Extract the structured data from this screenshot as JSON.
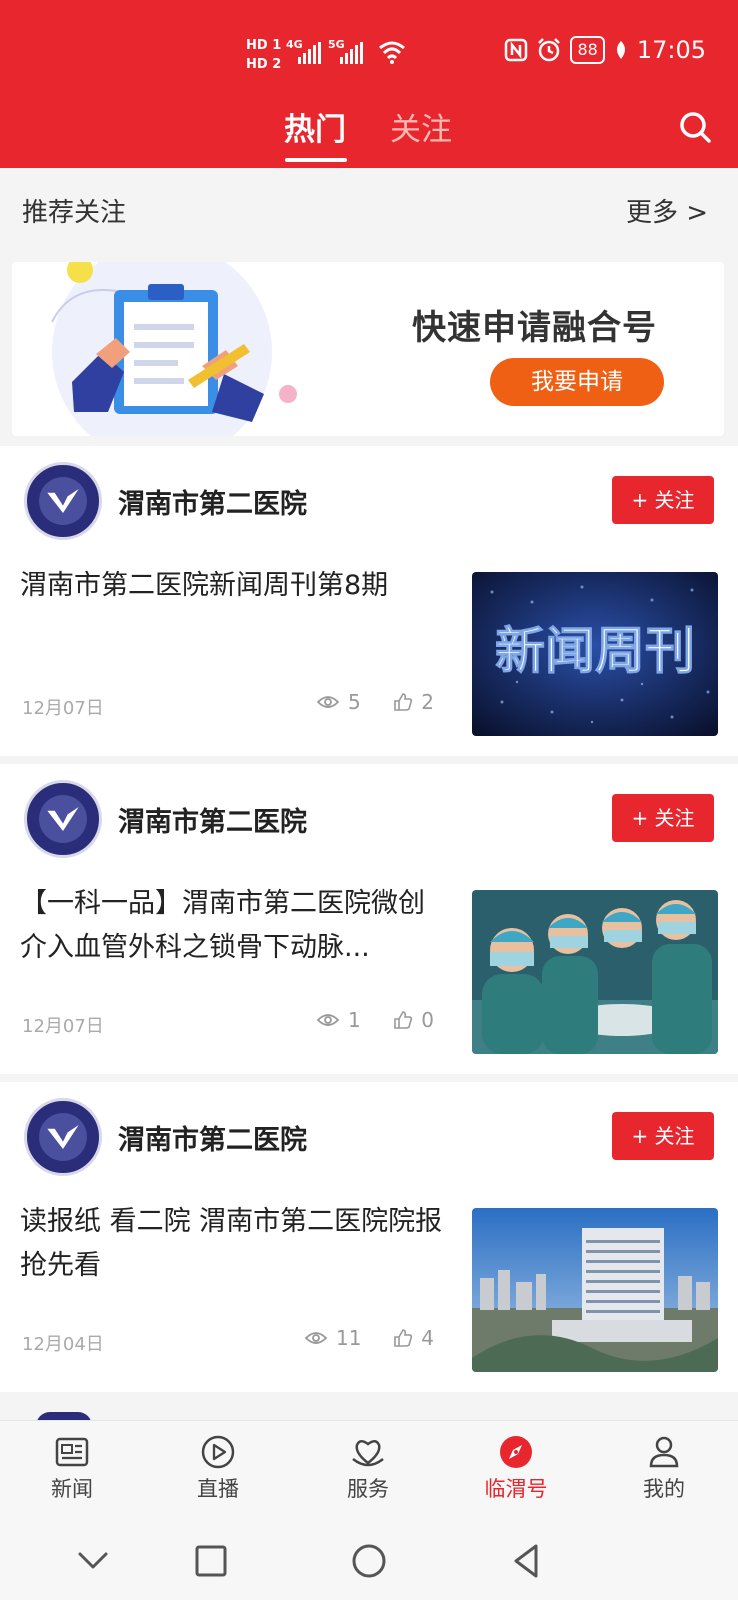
{
  "status_bar": {
    "hd1": "HD 1",
    "hd2": "HD 2",
    "net1": "4G",
    "net2": "5G",
    "battery": "88",
    "time": "17:05"
  },
  "header": {
    "tabs": [
      {
        "label": "热门",
        "active": true
      },
      {
        "label": "关注",
        "active": false
      }
    ],
    "search_icon": "search-icon",
    "background_color": "#e8262e"
  },
  "recommend": {
    "title": "推荐关注",
    "more": "更多 >"
  },
  "banner": {
    "title": "快速申请融合号",
    "button": "我要申请"
  },
  "feed": [
    {
      "source": "渭南市第二医院",
      "follow": "+ 关注",
      "title": "渭南市第二医院新闻周刊第8期",
      "date": "12月07日",
      "views": "5",
      "likes": "2",
      "thumb": "新闻周刊"
    },
    {
      "source": "渭南市第二医院",
      "follow": "+ 关注",
      "title": "【一科一品】渭南市第二医院微创介入血管外科之锁骨下动脉...",
      "date": "12月07日",
      "views": "1",
      "likes": "0",
      "thumb": ""
    },
    {
      "source": "渭南市第二医院",
      "follow": "+ 关注",
      "title": "读报纸 看二院 渭南市第二医院院报抢先看",
      "date": "12月04日",
      "views": "11",
      "likes": "4",
      "thumb": ""
    }
  ],
  "bottom_nav": [
    {
      "label": "新闻",
      "icon": "news-icon",
      "active": false
    },
    {
      "label": "直播",
      "icon": "play-icon",
      "active": false
    },
    {
      "label": "服务",
      "icon": "service-heart-icon",
      "active": false
    },
    {
      "label": "临渭号",
      "icon": "compass-icon",
      "active": true
    },
    {
      "label": "我的",
      "icon": "user-icon",
      "active": false
    }
  ],
  "colors": {
    "accent": "#e8262e",
    "banner_button": "#f06014"
  }
}
